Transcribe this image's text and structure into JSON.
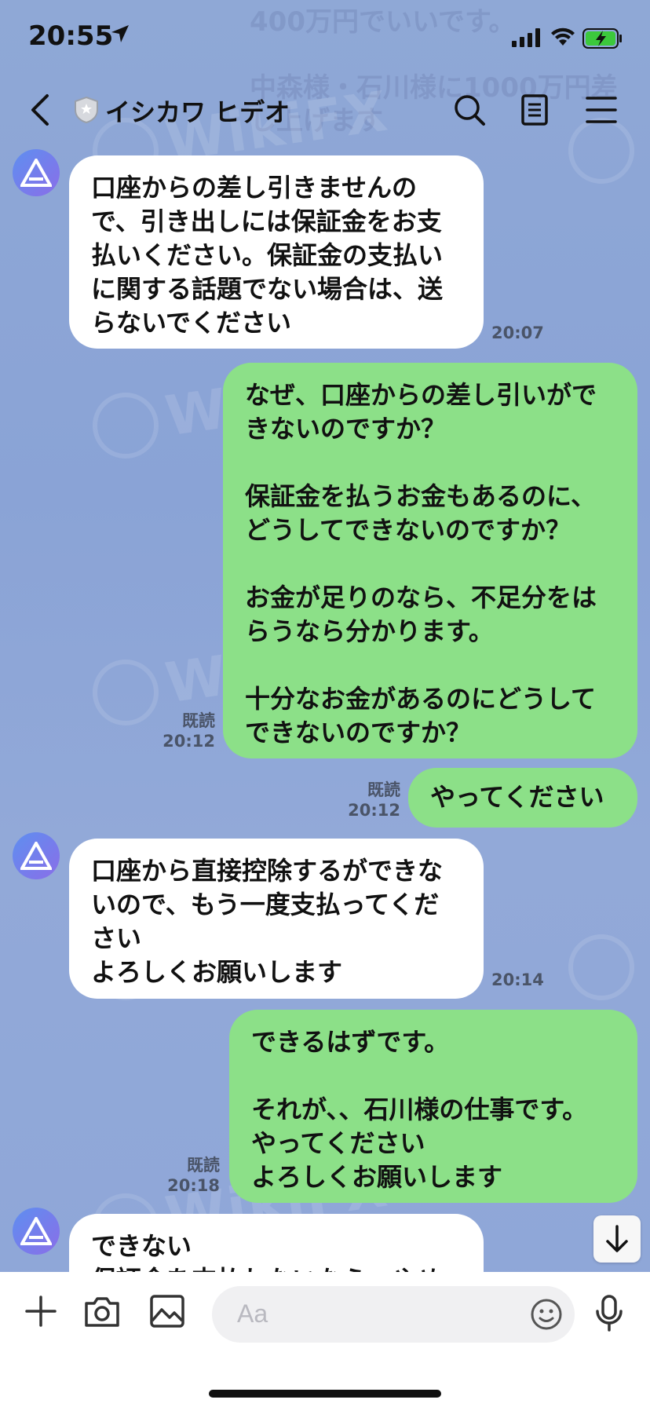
{
  "status_bar": {
    "time": "20:55"
  },
  "background_text": {
    "line1": "400万円でいいです。",
    "line2": "中森様・石川様に1000万円差",
    "line3": "し上げます"
  },
  "watermark": {
    "text": "WikiFX"
  },
  "header": {
    "title": "イシカワ ヒデオ",
    "back_icon": "chevron-left-icon",
    "search_icon": "search-icon",
    "notes_icon": "notes-icon",
    "menu_icon": "menu-icon"
  },
  "messages": [
    {
      "side": "in",
      "text": "口座からの差し引きませんの\nで、引き出しには保証金をお支\n払いください。保証金の支払い\nに関する話題でない場合は、送\nらないでください",
      "time": "20:07"
    },
    {
      "side": "out",
      "text": "なぜ、口座からの差し引いがで\nきないのですか？\n\n保証金を払うお金もあるのに、\nどうしてできないのですか？\n\nお金が足りのなら、不足分をは\nらうなら分かります。\n\n十分なお金があるのにどうして\nできないのですか？",
      "read": "既読",
      "time": "20:12"
    },
    {
      "side": "out",
      "text": "やってください",
      "read": "既読",
      "time": "20:12"
    },
    {
      "side": "in",
      "text": "口座から直接控除するができな\nいので、もう一度支払ってくだ\nさい\nよろしくお願いします",
      "time": "20:14"
    },
    {
      "side": "out",
      "text": "できるはずです。\n\nそれが、、石川様の仕事です。\nやってください\nよろしくお願いします",
      "read": "既読",
      "time": "20:18"
    },
    {
      "side": "in",
      "text": "できない\n保証金を支払わないなら、やめ",
      "time": ""
    }
  ],
  "input": {
    "placeholder": "Aa"
  },
  "bottom_icons": [
    "plus-icon",
    "camera-icon",
    "image-icon",
    "emoji-icon",
    "microphone-icon"
  ],
  "colors": {
    "background": "#8fa8d6",
    "outgoing_bubble": "#8ce088",
    "incoming_bubble": "#ffffff"
  }
}
